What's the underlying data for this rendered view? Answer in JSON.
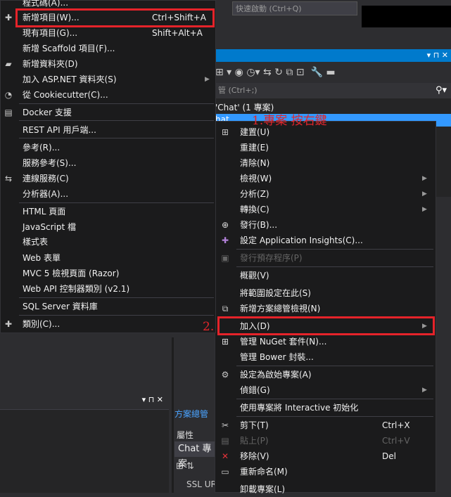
{
  "ide": {
    "search_placeholder": "快速啟動 (Ctrl+Q)",
    "solution_explorer": {
      "header_icons": "▾ ⊓ ✕",
      "search_label": "管 (Ctrl+;)",
      "search_icon": "search-icon",
      "solution_node": "'Chat' (1 專案)",
      "project_node": "hat",
      "tab_label": "方案總管"
    },
    "bottom_panel_icons": "▾ ⊓ ✕",
    "properties": {
      "title": "屬性",
      "object_name": "Chat 專案",
      "row_label": "SSL UR"
    }
  },
  "annotations": {
    "step1": "1.專案 按右鍵",
    "step2": "2."
  },
  "add_submenu": {
    "items": [
      {
        "label": "程式碼(A)...",
        "icon": "",
        "shortcut": ""
      },
      {
        "label": "新增項目(W)...",
        "icon": "new-item-icon",
        "shortcut": "Ctrl+Shift+A"
      },
      {
        "label": "現有項目(G)...",
        "icon": "",
        "shortcut": "Shift+Alt+A"
      },
      {
        "label": "新增 Scaffold 項目(F)...",
        "icon": "",
        "shortcut": ""
      },
      {
        "label": "新增資料夾(D)",
        "icon": "folder-icon",
        "shortcut": ""
      },
      {
        "label": "加入 ASP.NET 資料夾(S)",
        "icon": "",
        "shortcut": "",
        "submenu": true
      },
      {
        "label": "從 Cookiecutter(C)...",
        "icon": "cookiecutter-icon",
        "shortcut": ""
      },
      {
        "label": "Docker 支援",
        "icon": "docker-icon",
        "shortcut": ""
      },
      {
        "label": "REST API 用戶端...",
        "icon": "",
        "shortcut": ""
      },
      {
        "label": "參考(R)...",
        "icon": "",
        "shortcut": ""
      },
      {
        "label": "服務參考(S)...",
        "icon": "",
        "shortcut": ""
      },
      {
        "label": "連線服務(C)",
        "icon": "connected-service-icon",
        "shortcut": ""
      },
      {
        "label": "分析器(A)...",
        "icon": "",
        "shortcut": ""
      },
      {
        "label": "HTML 頁面",
        "icon": "",
        "shortcut": ""
      },
      {
        "label": "JavaScript 檔",
        "icon": "",
        "shortcut": ""
      },
      {
        "label": "樣式表",
        "icon": "",
        "shortcut": ""
      },
      {
        "label": "Web 表單",
        "icon": "",
        "shortcut": ""
      },
      {
        "label": "MVC 5 檢視頁面 (Razor)",
        "icon": "",
        "shortcut": ""
      },
      {
        "label": "Web API 控制器類別 (v2.1)",
        "icon": "",
        "shortcut": ""
      },
      {
        "label": "SQL Server 資料庫",
        "icon": "",
        "shortcut": ""
      },
      {
        "label": "類別(C)...",
        "icon": "class-icon",
        "shortcut": ""
      }
    ]
  },
  "context_menu": {
    "items": [
      {
        "label": "建置(U)",
        "icon": "build-icon"
      },
      {
        "label": "重建(E)"
      },
      {
        "label": "清除(N)"
      },
      {
        "label": "檢視(W)",
        "submenu": true
      },
      {
        "label": "分析(Z)",
        "submenu": true
      },
      {
        "label": "轉換(C)",
        "submenu": true
      },
      {
        "label": "發行(B)...",
        "icon": "globe-icon"
      },
      {
        "label": "設定 Application Insights(C)...",
        "icon": "insights-icon"
      },
      {
        "label": "發行預存程序(P)",
        "icon": "publish-proc-icon",
        "disabled": true
      },
      {
        "label": "概觀(V)"
      },
      {
        "label": "將範圍設定在此(S)"
      },
      {
        "label": "新增方案總管檢視(N)",
        "icon": "new-view-icon"
      },
      {
        "label": "加入(D)",
        "submenu": true
      },
      {
        "label": "管理 NuGet 套件(N)...",
        "icon": "nuget-icon"
      },
      {
        "label": "管理 Bower 封裝..."
      },
      {
        "label": "設定為啟始專案(A)",
        "icon": "gear-icon"
      },
      {
        "label": "偵錯(G)",
        "submenu": true
      },
      {
        "label": "使用專案將 Interactive 初始化"
      },
      {
        "label": "剪下(T)",
        "icon": "scissors-icon",
        "shortcut": "Ctrl+X"
      },
      {
        "label": "貼上(P)",
        "icon": "paste-icon",
        "shortcut": "Ctrl+V",
        "disabled": true
      },
      {
        "label": "移除(V)",
        "icon": "remove-icon",
        "shortcut": "Del"
      },
      {
        "label": "重新命名(M)",
        "icon": "rename-icon"
      },
      {
        "label": "卸載專案(L)"
      }
    ]
  },
  "colors": {
    "highlight_border": "#e5232a",
    "selection": "#3399ff",
    "accent": "#007acc"
  }
}
